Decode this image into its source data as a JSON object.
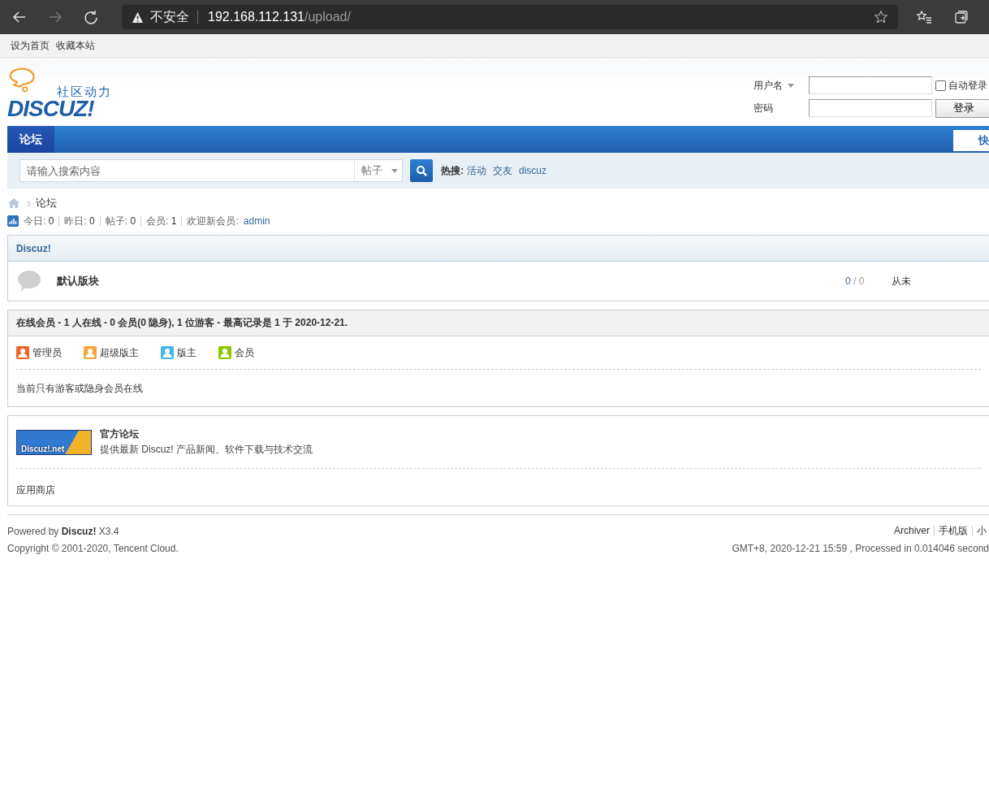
{
  "browser": {
    "security_label": "不安全",
    "url_host": "192.168.112.131",
    "url_path": "/upload/"
  },
  "toolbar": [
    "设为首页",
    "收藏本站"
  ],
  "logo": {
    "tagline": "社区动力",
    "wordmark": "DISCUZ!"
  },
  "login": {
    "username_label": "用户名",
    "password_label": "密码",
    "auto_login": {
      "label": "自动登录",
      "checked": false
    },
    "button": "登录"
  },
  "nav": {
    "tabs": [
      {
        "label": "论坛",
        "selected": true
      }
    ],
    "quick": "快"
  },
  "search": {
    "placeholder": "请输入搜索内容",
    "type": "帖子",
    "hot_label": "热搜:",
    "hot": [
      "活动",
      "交友",
      "discuz"
    ]
  },
  "breadcrumb": [
    "论坛"
  ],
  "stats": [
    {
      "label": "今日:",
      "value": "0"
    },
    {
      "label": "昨日:",
      "value": "0"
    },
    {
      "label": "帖子:",
      "value": "0"
    },
    {
      "label": "会员:",
      "value": "1"
    }
  ],
  "newest_member": {
    "label": "欢迎新会员:",
    "name": "admin"
  },
  "category": {
    "title": "Discuz!",
    "forums": [
      {
        "name": "默认版块",
        "threads": "0",
        "separator": "/",
        "posts": "0",
        "last_post": "从未"
      }
    ]
  },
  "online": {
    "title": "在线会员 - 1 人在线 - 0 会员(0 隐身), 1 位游客 - 最高记录是 1 于 2020-12-21.",
    "legend": [
      {
        "label": "管理员",
        "color": "#f0642c"
      },
      {
        "label": "超级版主",
        "color": "#f5a33a"
      },
      {
        "label": "版主",
        "color": "#45b6e9"
      },
      {
        "label": "会员",
        "color": "#8cc800"
      }
    ],
    "message": "当前只有游客或隐身会员在线"
  },
  "links": {
    "featured": {
      "banner": "Discuz!.net",
      "title": "官方论坛",
      "description": "提供最新 Discuz! 产品新闻、软件下载与技术交流"
    },
    "text_links": [
      "应用商店"
    ]
  },
  "footer": {
    "powered_by": "Powered by",
    "brand": "Discuz!",
    "version": "X3.4",
    "copyright": "Copyright © 2001-2020, Tencent Cloud.",
    "links": [
      "Archiver",
      "手机版",
      "小"
    ],
    "info": "GMT+8, 2020-12-21 15:59 , Processed in 0.014046 second"
  }
}
